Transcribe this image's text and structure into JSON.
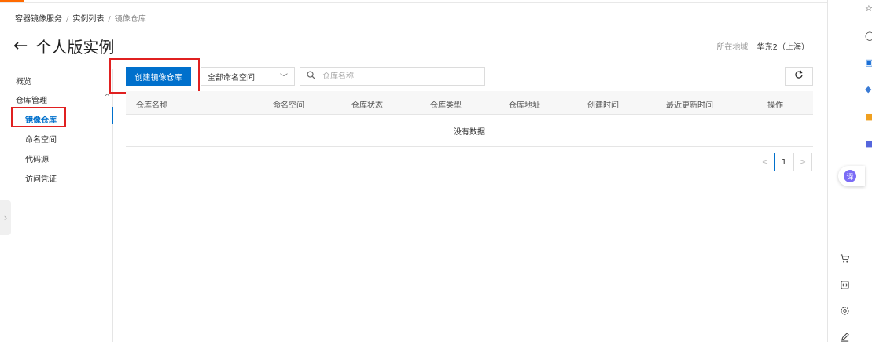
{
  "breadcrumb": [
    "容器镜像服务",
    "实例列表",
    "镜像仓库"
  ],
  "breadcrumb_sep": "/",
  "page": {
    "back_icon": "←",
    "title": "个人版实例"
  },
  "region": {
    "label": "所在地域",
    "value": "华东2（上海）"
  },
  "sidebar": {
    "overview": "概览",
    "repo_mgmt": "仓库管理",
    "items": [
      "镜像仓库",
      "命名空间",
      "代码源",
      "访问凭证"
    ]
  },
  "toolbar": {
    "create_label": "创建镜像仓库",
    "namespace_value": "全部命名空间",
    "search_placeholder": "仓库名称"
  },
  "table": {
    "columns": [
      "仓库名称",
      "命名空间",
      "仓库状态",
      "仓库类型",
      "仓库地址",
      "创建时间",
      "最近更新时间",
      "操作"
    ],
    "empty_text": "没有数据"
  },
  "pagination": {
    "current": "1",
    "prev": "<",
    "next": ">"
  },
  "colors": {
    "primary": "#0070cc",
    "highlight_box": "#e02020",
    "brand_orange": "#ff6a00"
  }
}
